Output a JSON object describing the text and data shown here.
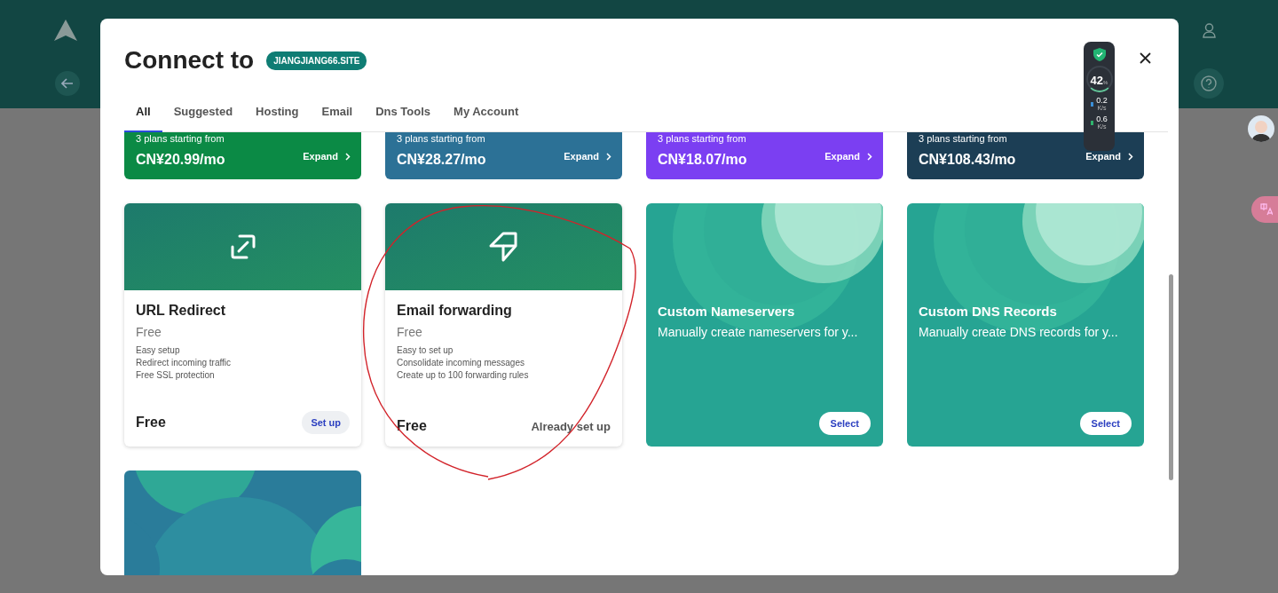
{
  "dialog": {
    "title": "Connect to",
    "domain": "JIANGJIANG66.SITE",
    "tabs": [
      {
        "label": "All",
        "selected": true
      },
      {
        "label": "Suggested",
        "selected": false
      },
      {
        "label": "Hosting",
        "selected": false
      },
      {
        "label": "Email",
        "selected": false
      },
      {
        "label": "Dns Tools",
        "selected": false
      },
      {
        "label": "My Account",
        "selected": false
      }
    ],
    "plan_cards": [
      {
        "subtitle": "3 plans starting from",
        "price": "CN¥20.99/mo",
        "action": "Expand",
        "color": "#0b8a45"
      },
      {
        "subtitle": "3 plans starting from",
        "price": "CN¥28.27/mo",
        "action": "Expand",
        "color": "#2c7196"
      },
      {
        "subtitle": "3 plans starting from",
        "price": "CN¥18.07/mo",
        "action": "Expand",
        "color": "#7b3ff2"
      },
      {
        "subtitle": "3 plans starting from",
        "price": "CN¥108.43/mo",
        "action": "Expand",
        "color": "#1c3e55"
      }
    ],
    "service_cards": [
      {
        "kind": "product",
        "title": "URL Redirect",
        "price": "Free",
        "features": [
          "Easy setup",
          "Redirect incoming traffic",
          "Free SSL protection"
        ],
        "footer_price": "Free",
        "action": {
          "kind": "button",
          "label": "Set up"
        }
      },
      {
        "kind": "product",
        "title": "Email forwarding",
        "price": "Free",
        "features": [
          "Easy to set up",
          "Consolidate incoming messages",
          "Create up to 100 forwarding rules"
        ],
        "footer_price": "Free",
        "action": {
          "kind": "status",
          "label": "Already set up"
        }
      },
      {
        "kind": "promo",
        "title": "Custom Nameservers",
        "description": "Manually create nameservers for y...",
        "action": {
          "kind": "button",
          "label": "Select"
        }
      },
      {
        "kind": "promo",
        "title": "Custom DNS Records",
        "description": "Manually create DNS records for y...",
        "action": {
          "kind": "button",
          "label": "Select"
        }
      },
      {
        "kind": "picture"
      }
    ]
  },
  "network_monitor": {
    "percent": "42",
    "unit": "%",
    "upload": "0.2",
    "upload_unit": "K/s",
    "download": "0.6",
    "download_unit": "K/s"
  }
}
